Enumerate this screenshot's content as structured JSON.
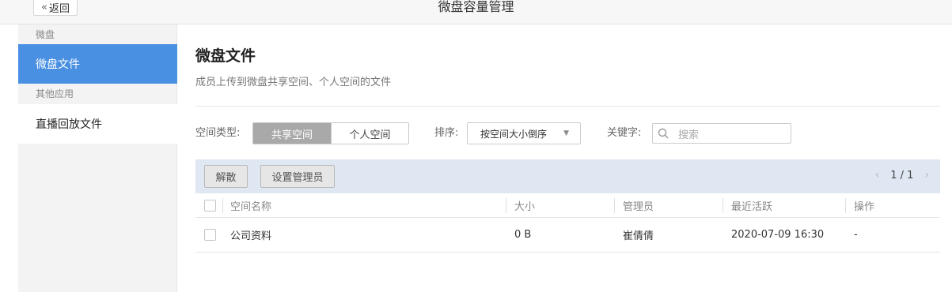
{
  "header": {
    "back_label": "返回",
    "title": "微盘容量管理"
  },
  "sidebar": {
    "group1": "微盘",
    "item_active": "微盘文件",
    "group2": "其他应用",
    "item_live": "直播回放文件"
  },
  "main": {
    "title": "微盘文件",
    "description": "成员上传到微盘共享空间、个人空间的文件",
    "filters": {
      "space_type_label": "空间类型:",
      "space_shared": "共享空间",
      "space_personal": "个人空间",
      "sort_label": "排序:",
      "sort_value": "按空间大小倒序",
      "keyword_label": "关键字:",
      "search_placeholder": "搜索"
    },
    "toolbar": {
      "dissolve": "解散",
      "set_admin": "设置管理员",
      "page": "1 / 1"
    },
    "table": {
      "headers": [
        "空间名称",
        "大小",
        "管理员",
        "最近活跃",
        "操作"
      ],
      "rows": [
        {
          "name": "公司资料",
          "size": "0 B",
          "admin": "崔倩倩",
          "last_active": "2020-07-09 16:30",
          "action": "-"
        }
      ]
    }
  }
}
